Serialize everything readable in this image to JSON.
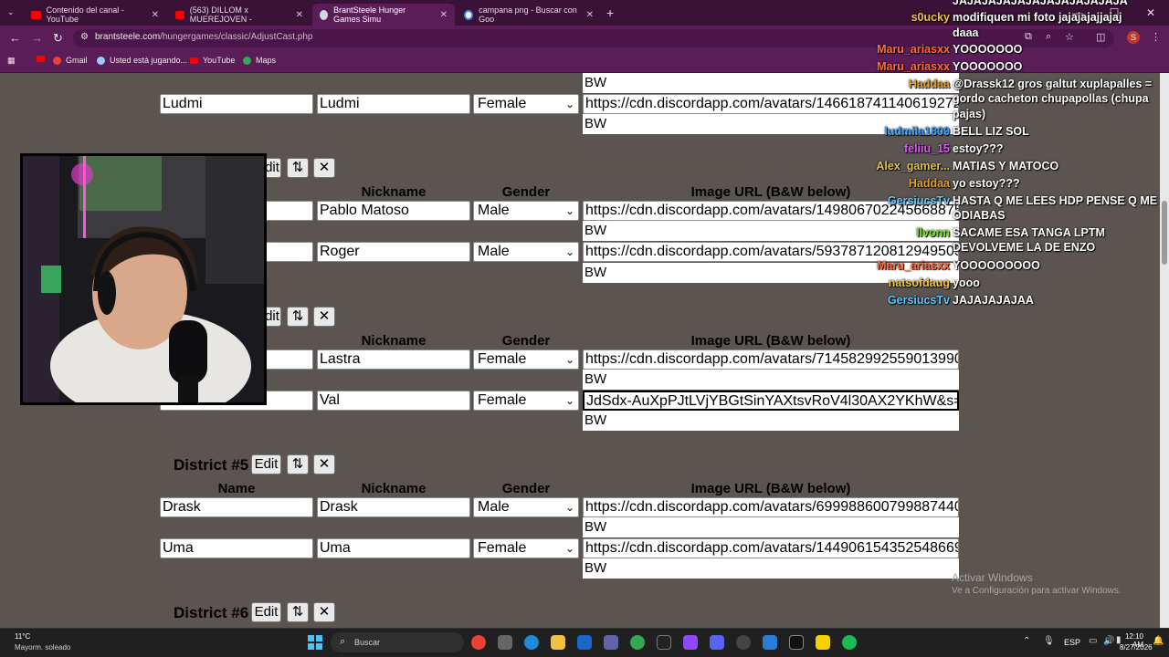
{
  "browser": {
    "tabs": [
      {
        "label": "Contenido del canal - YouTube",
        "active": false
      },
      {
        "label": "(563) DILLOM x MUEREJOVEN -",
        "active": false
      },
      {
        "label": "BrantSteele Hunger Games Simu",
        "active": true
      },
      {
        "label": "campana png - Buscar con Goo",
        "active": false
      }
    ],
    "url_host": "brantsteele.com",
    "url_path": "/hungergames/classic/AdjustCast.php",
    "bookmarks": [
      "Gmail",
      "Usted está jugando...",
      "YouTube",
      "Maps"
    ]
  },
  "page": {
    "headers": {
      "name": "Name",
      "nickname": "Nickname",
      "gender": "Gender",
      "image": "Image URL (B&W below)"
    },
    "edit_label": "Edit",
    "sort_label": "⇅",
    "remove_label": "✕",
    "bw_label": "BW",
    "d3_top": {
      "name": "Ludmi",
      "nickname": "Ludmi",
      "gender": "Female",
      "image": "https://cdn.discordapp.com/avatars/1466187411406192722/"
    },
    "d3": {
      "tributes": [
        {
          "name": "",
          "nickname": "Pablo Matoso",
          "gender": "Male",
          "image": "https://cdn.discordapp.com/avatars/1498067022456688751/"
        },
        {
          "name": "",
          "nickname": "Roger",
          "gender": "Male",
          "image": "https://cdn.discordapp.com/avatars/593787120812949505/a"
        }
      ]
    },
    "d4": {
      "tributes": [
        {
          "name": "",
          "nickname": "Lastra",
          "gender": "Female",
          "image": "https://cdn.discordapp.com/avatars/714582992559013990/70"
        },
        {
          "name": "",
          "nickname": "Val",
          "gender": "Female",
          "image": "JdSdx-AuXpPJtLVjYBGtSinYAXtsvRoV4l30AX2YKhW&s=10"
        }
      ]
    },
    "d5": {
      "title": "District #5",
      "tributes": [
        {
          "name": "Drask",
          "nickname": "Drask",
          "gender": "Male",
          "image": "https://cdn.discordapp.com/avatars/699988600799887440/a0"
        },
        {
          "name": "Uma",
          "nickname": "Uma",
          "gender": "Female",
          "image": "https://cdn.discordapp.com/avatars/1449061543525486696/a"
        }
      ]
    },
    "d6": {
      "title": "District #6"
    }
  },
  "chat": [
    {
      "name": "",
      "text": "JAJAJAJAJAJAJAJAJAJAJAJA",
      "color": "#ffffff"
    },
    {
      "name": "s0ucky",
      "text": "modifiquen mi foto jajajajajjajaj",
      "color": "#f2c14e"
    },
    {
      "name": "",
      "text": "daaa",
      "color": "#ffffff"
    },
    {
      "name": "Maru_ariasxx",
      "text": "YOOOOOOO",
      "color": "#ff6b3d"
    },
    {
      "name": "Maru_ariasxx",
      "text": "YOOOOOOO",
      "color": "#ff6b3d"
    },
    {
      "name": "Haddaa",
      "text": "@Drassk12 gros galtut xuplapalles =",
      "color": "#e0a030"
    },
    {
      "name": "",
      "text": "gordo cacheton chupapollas (chupa",
      "color": "#ffffff"
    },
    {
      "name": "",
      "text": "pajas)",
      "color": "#ffffff"
    },
    {
      "name": "ludmila1809",
      "text": "BELL LIZ SOL",
      "color": "#3aa0ff"
    },
    {
      "name": "feliiu_15",
      "text": "estoy???",
      "color": "#d65cf0"
    },
    {
      "name": "Alex_gamer...",
      "text": "MATIAS Y MATOCO",
      "color": "#e0c050"
    },
    {
      "name": "Haddaa",
      "text": "yo estoy???",
      "color": "#e0a030"
    },
    {
      "name": "GersiucsTv",
      "text": "HASTA Q ME LEES HDP PENSE Q ME",
      "color": "#5ec8ff"
    },
    {
      "name": "",
      "text": "ODIABAS",
      "color": "#ffffff"
    },
    {
      "name": "llvonn",
      "text": "SACAME ESA TANGA LPTM",
      "color": "#7cd83a"
    },
    {
      "name": "",
      "text": "DEVOLVEME LA DE ENZO",
      "color": "#ffffff"
    },
    {
      "name": "Maru_ariasxx",
      "text": "YOOOOOOOOO",
      "color": "#ff6b3d"
    },
    {
      "name": "natsofdaug",
      "text": "yooo",
      "color": "#f2c14e"
    },
    {
      "name": "GersiucsTv",
      "text": "JAJAJAJAJAA",
      "color": "#5ec8ff"
    }
  ],
  "watermark": {
    "title": "Activar Windows",
    "subtitle": "Ve a Configuración para activar Windows."
  },
  "taskbar": {
    "weather_temp": "11°C",
    "weather_desc": "Mayorm. soleado",
    "search_placeholder": "Buscar",
    "lang": "ESP",
    "time": "12:10 AM",
    "date": "8/27/2026"
  }
}
